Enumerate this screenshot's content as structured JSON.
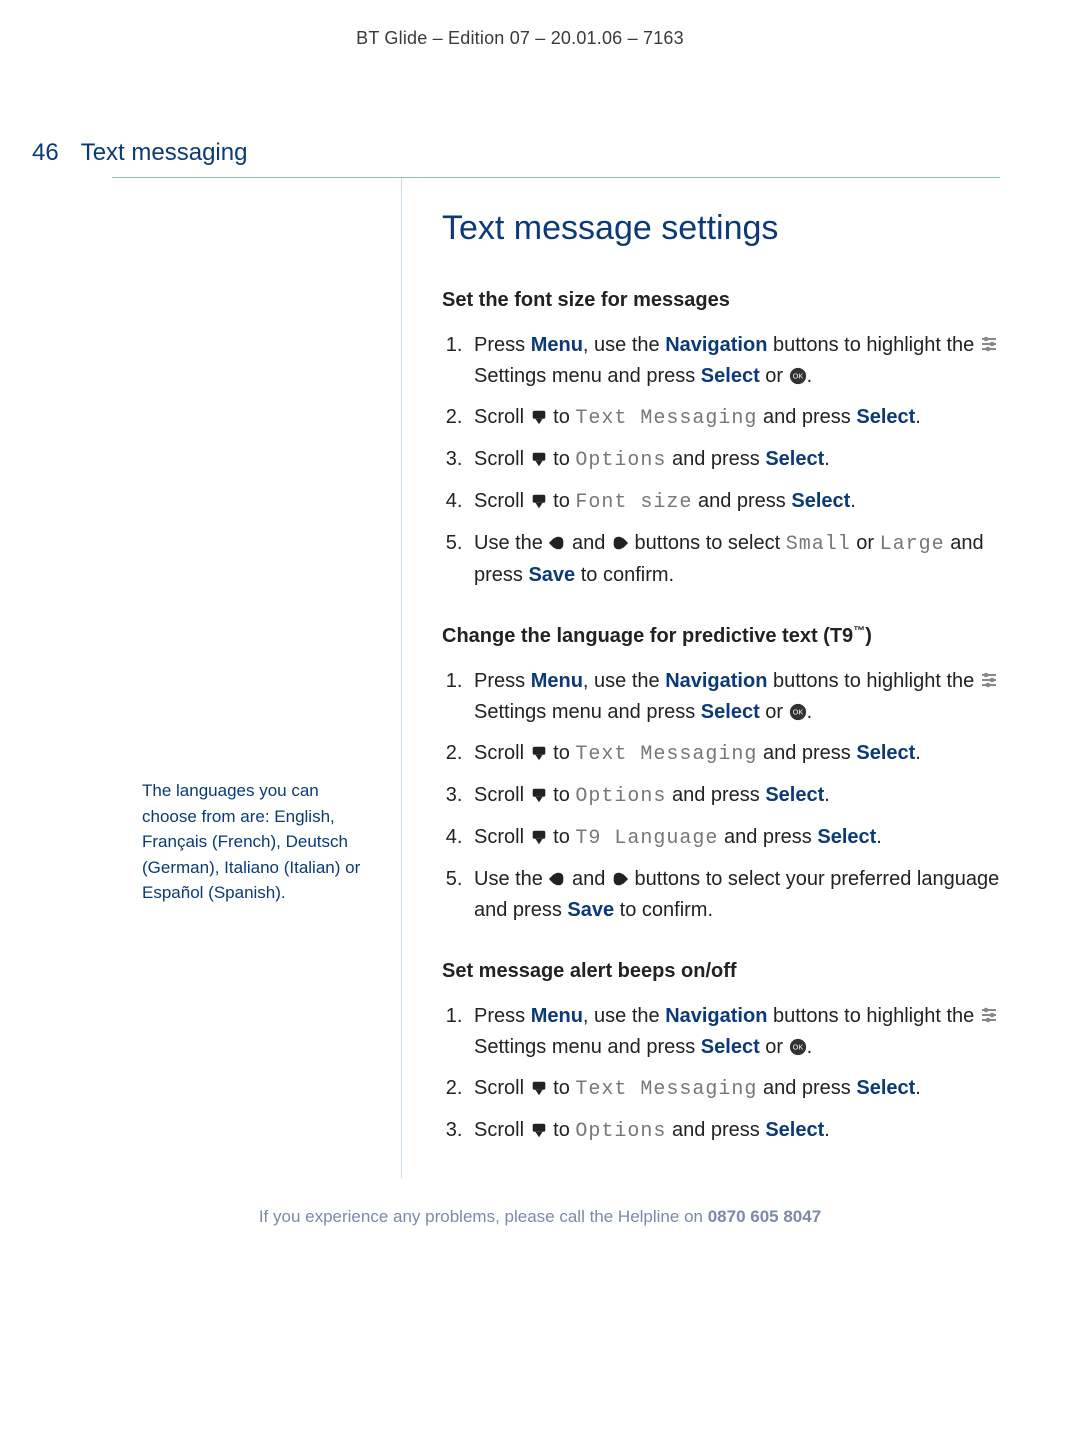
{
  "doc_header": "BT Glide – Edition 07 – 20.01.06 – 7163",
  "page_number": "46",
  "chapter_title": "Text messaging",
  "sidebar_note": "The languages you can choose from are: English, Français (French), Deutsch (German), Italiano (Italian) or Español (Spanish).",
  "main_heading": "Text message settings",
  "sections": {
    "font": {
      "title": "Set the font size for messages",
      "step1_a": "Press ",
      "step1_menu": "Menu",
      "step1_b": ", use the ",
      "step1_nav": "Navigation",
      "step1_c": " buttons to highlight the ",
      "step1_d": " Settings menu and press ",
      "step1_select": "Select",
      "step1_e": " or ",
      "step1_f": ".",
      "step2_a": "Scroll ",
      "step2_b": " to ",
      "step2_mono": "Text Messaging",
      "step2_c": " and press ",
      "step2_select": "Select",
      "step2_d": ".",
      "step3_a": "Scroll ",
      "step3_b": " to ",
      "step3_mono": "Options",
      "step3_c": " and press ",
      "step3_select": "Select",
      "step3_d": ".",
      "step4_a": "Scroll ",
      "step4_b": " to ",
      "step4_mono": "Font size",
      "step4_c": " and press ",
      "step4_select": "Select",
      "step4_d": ".",
      "step5_a": "Use the ",
      "step5_b": " and ",
      "step5_c": " buttons to select ",
      "step5_mono1": "Small",
      "step5_d": " or ",
      "step5_mono2": "Large",
      "step5_e": " and press ",
      "step5_save": "Save",
      "step5_f": " to confirm."
    },
    "lang": {
      "title_a": "Change the language for predictive text (T9",
      "title_tm": "™",
      "title_b": ")",
      "step4_mono": "T9 Language",
      "step5_a": "Use the ",
      "step5_b": " and ",
      "step5_c": " buttons to select your preferred language and press ",
      "step5_save": "Save",
      "step5_d": " to confirm."
    },
    "alert": {
      "title": "Set message alert beeps on/off"
    }
  },
  "footer": {
    "text": "If you experience any problems, please call the Helpline on ",
    "phone": "0870 605 8047"
  }
}
